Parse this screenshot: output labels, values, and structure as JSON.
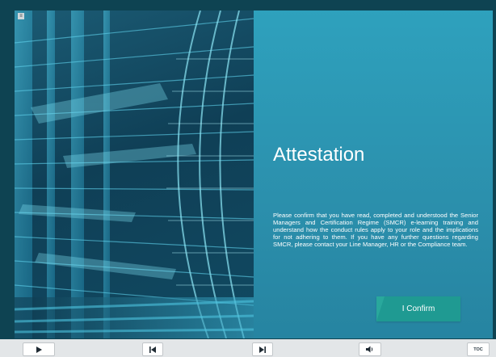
{
  "menu": {
    "icon": "menu-icon",
    "glyph": "≡"
  },
  "slide": {
    "title": "Attestation",
    "body": "Please confirm that you have read, completed and understood the Senior Managers and Certification Regime (SMCR) e-learning training and understand how the conduct rules apply to your role and the implications for not adhering to them. If you have any further questions regarding SMCR, please contact your Line Manager, HR or the Compliance team.",
    "confirm_label": "I Confirm",
    "accent_color": "#1f9a92"
  },
  "controls": {
    "play_icon": "play-icon",
    "previous_icon": "skip-back-icon",
    "next_icon": "skip-forward-icon",
    "volume_icon": "volume-icon",
    "toc_label": "TOC"
  }
}
